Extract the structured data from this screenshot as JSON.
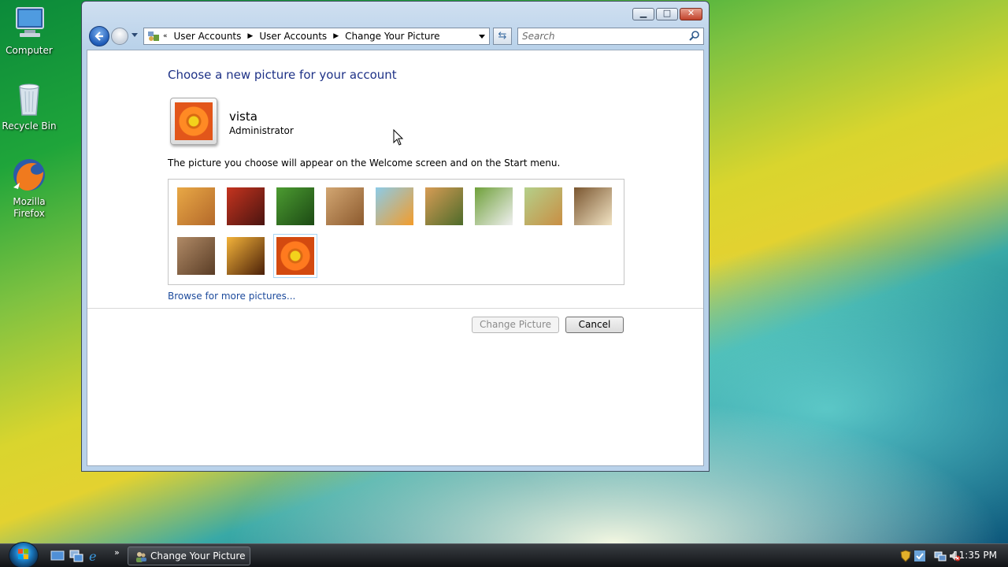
{
  "desktop": {
    "icons": [
      {
        "label": "Computer"
      },
      {
        "label": "Recycle Bin"
      },
      {
        "label": "Mozilla Firefox"
      }
    ]
  },
  "window": {
    "address": {
      "chevron": "«",
      "crumbs": [
        "User Accounts",
        "User Accounts",
        "Change Your Picture"
      ]
    },
    "search_placeholder": "Search",
    "heading": "Choose a new picture for your account",
    "user": {
      "name": "vista",
      "role": "Administrator"
    },
    "description": "The picture you choose will appear on the Welcome screen and on the Start menu.",
    "pictures": [
      {
        "name": "bass-clef",
        "colors": [
          "#e8a846",
          "#b4692a"
        ]
      },
      {
        "name": "starfish",
        "colors": [
          "#c5341f",
          "#4a1410"
        ]
      },
      {
        "name": "leaf",
        "colors": [
          "#4c9b31",
          "#1c4a14"
        ]
      },
      {
        "name": "robot",
        "colors": [
          "#d2a672",
          "#8c5a2e"
        ]
      },
      {
        "name": "fish",
        "colors": [
          "#8ccbe8",
          "#f39c2a"
        ]
      },
      {
        "name": "bonsai",
        "colors": [
          "#d79c55",
          "#4d6b2a"
        ]
      },
      {
        "name": "soccer-ball",
        "colors": [
          "#6fa03a",
          "#f0f0f0"
        ]
      },
      {
        "name": "puppy",
        "colors": [
          "#b4d08a",
          "#c98e43"
        ]
      },
      {
        "name": "chess",
        "colors": [
          "#7a5630",
          "#f2e4c4"
        ]
      },
      {
        "name": "kitten",
        "colors": [
          "#b08a66",
          "#5a3d26"
        ]
      },
      {
        "name": "sparkles",
        "colors": [
          "#f3b33a",
          "#4a1f08"
        ]
      },
      {
        "name": "flower",
        "colors": [
          "#ff7a1f",
          "#d34a10"
        ]
      }
    ],
    "selected_picture": "flower",
    "browse_link": "Browse for more pictures...",
    "buttons": {
      "change": "Change Picture",
      "cancel": "Cancel"
    }
  },
  "taskbar": {
    "task_label": "Change Your Picture",
    "time": "11:35 PM"
  }
}
